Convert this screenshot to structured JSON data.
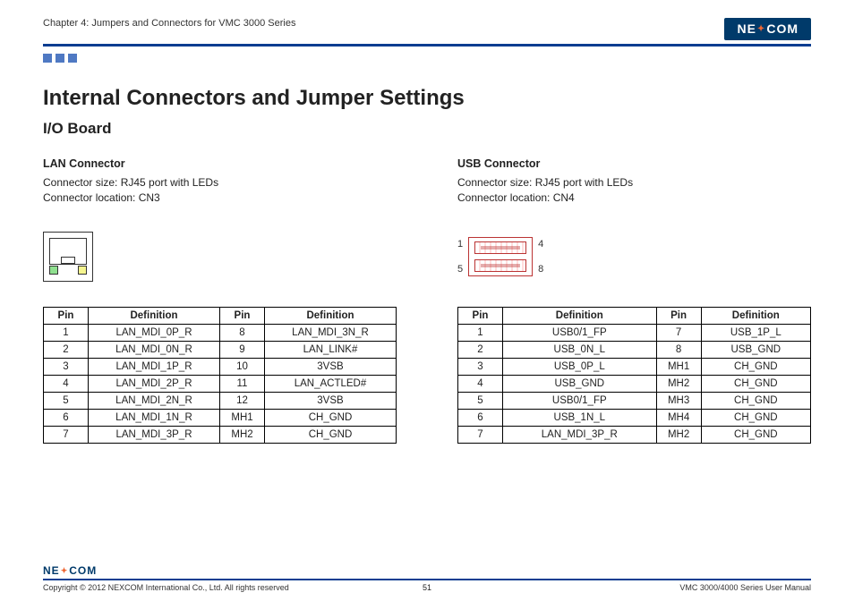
{
  "header": {
    "chapter": "Chapter 4: Jumpers and Connectors for VMC 3000 Series",
    "logo_text": "NE  COM"
  },
  "title": "Internal Connectors and Jumper Settings",
  "subtitle": "I/O Board",
  "lan": {
    "title": "LAN Connector",
    "size_label": "Connector size: RJ45 port with LEDs",
    "loc_label": "Connector location: CN3",
    "table_head": [
      "Pin",
      "Definition",
      "Pin",
      "Definition"
    ],
    "rows": [
      [
        "1",
        "LAN_MDI_0P_R",
        "8",
        "LAN_MDI_3N_R"
      ],
      [
        "2",
        "LAN_MDI_0N_R",
        "9",
        "LAN_LINK#"
      ],
      [
        "3",
        "LAN_MDI_1P_R",
        "10",
        "3VSB"
      ],
      [
        "4",
        "LAN_MDI_2P_R",
        "11",
        "LAN_ACTLED#"
      ],
      [
        "5",
        "LAN_MDI_2N_R",
        "12",
        "3VSB"
      ],
      [
        "6",
        "LAN_MDI_1N_R",
        "MH1",
        "CH_GND"
      ],
      [
        "7",
        "LAN_MDI_3P_R",
        "MH2",
        "CH_GND"
      ]
    ]
  },
  "usb": {
    "title": "USB Connector",
    "size_label": "Connector size: RJ45 port with LEDs",
    "loc_label": "Connector location: CN4",
    "pin_labels": {
      "tl": "1",
      "tr": "4",
      "bl": "5",
      "br": "8"
    },
    "table_head": [
      "Pin",
      "Definition",
      "Pin",
      "Definition"
    ],
    "rows": [
      [
        "1",
        "USB0/1_FP",
        "7",
        "USB_1P_L"
      ],
      [
        "2",
        "USB_0N_L",
        "8",
        "USB_GND"
      ],
      [
        "3",
        "USB_0P_L",
        "MH1",
        "CH_GND"
      ],
      [
        "4",
        "USB_GND",
        "MH2",
        "CH_GND"
      ],
      [
        "5",
        "USB0/1_FP",
        "MH3",
        "CH_GND"
      ],
      [
        "6",
        "USB_1N_L",
        "MH4",
        "CH_GND"
      ],
      [
        "7",
        "LAN_MDI_3P_R",
        "MH2",
        "CH_GND"
      ]
    ]
  },
  "footer": {
    "copyright": "Copyright © 2012 NEXCOM International Co., Ltd. All rights reserved",
    "page": "51",
    "doc": "VMC 3000/4000 Series User Manual"
  }
}
